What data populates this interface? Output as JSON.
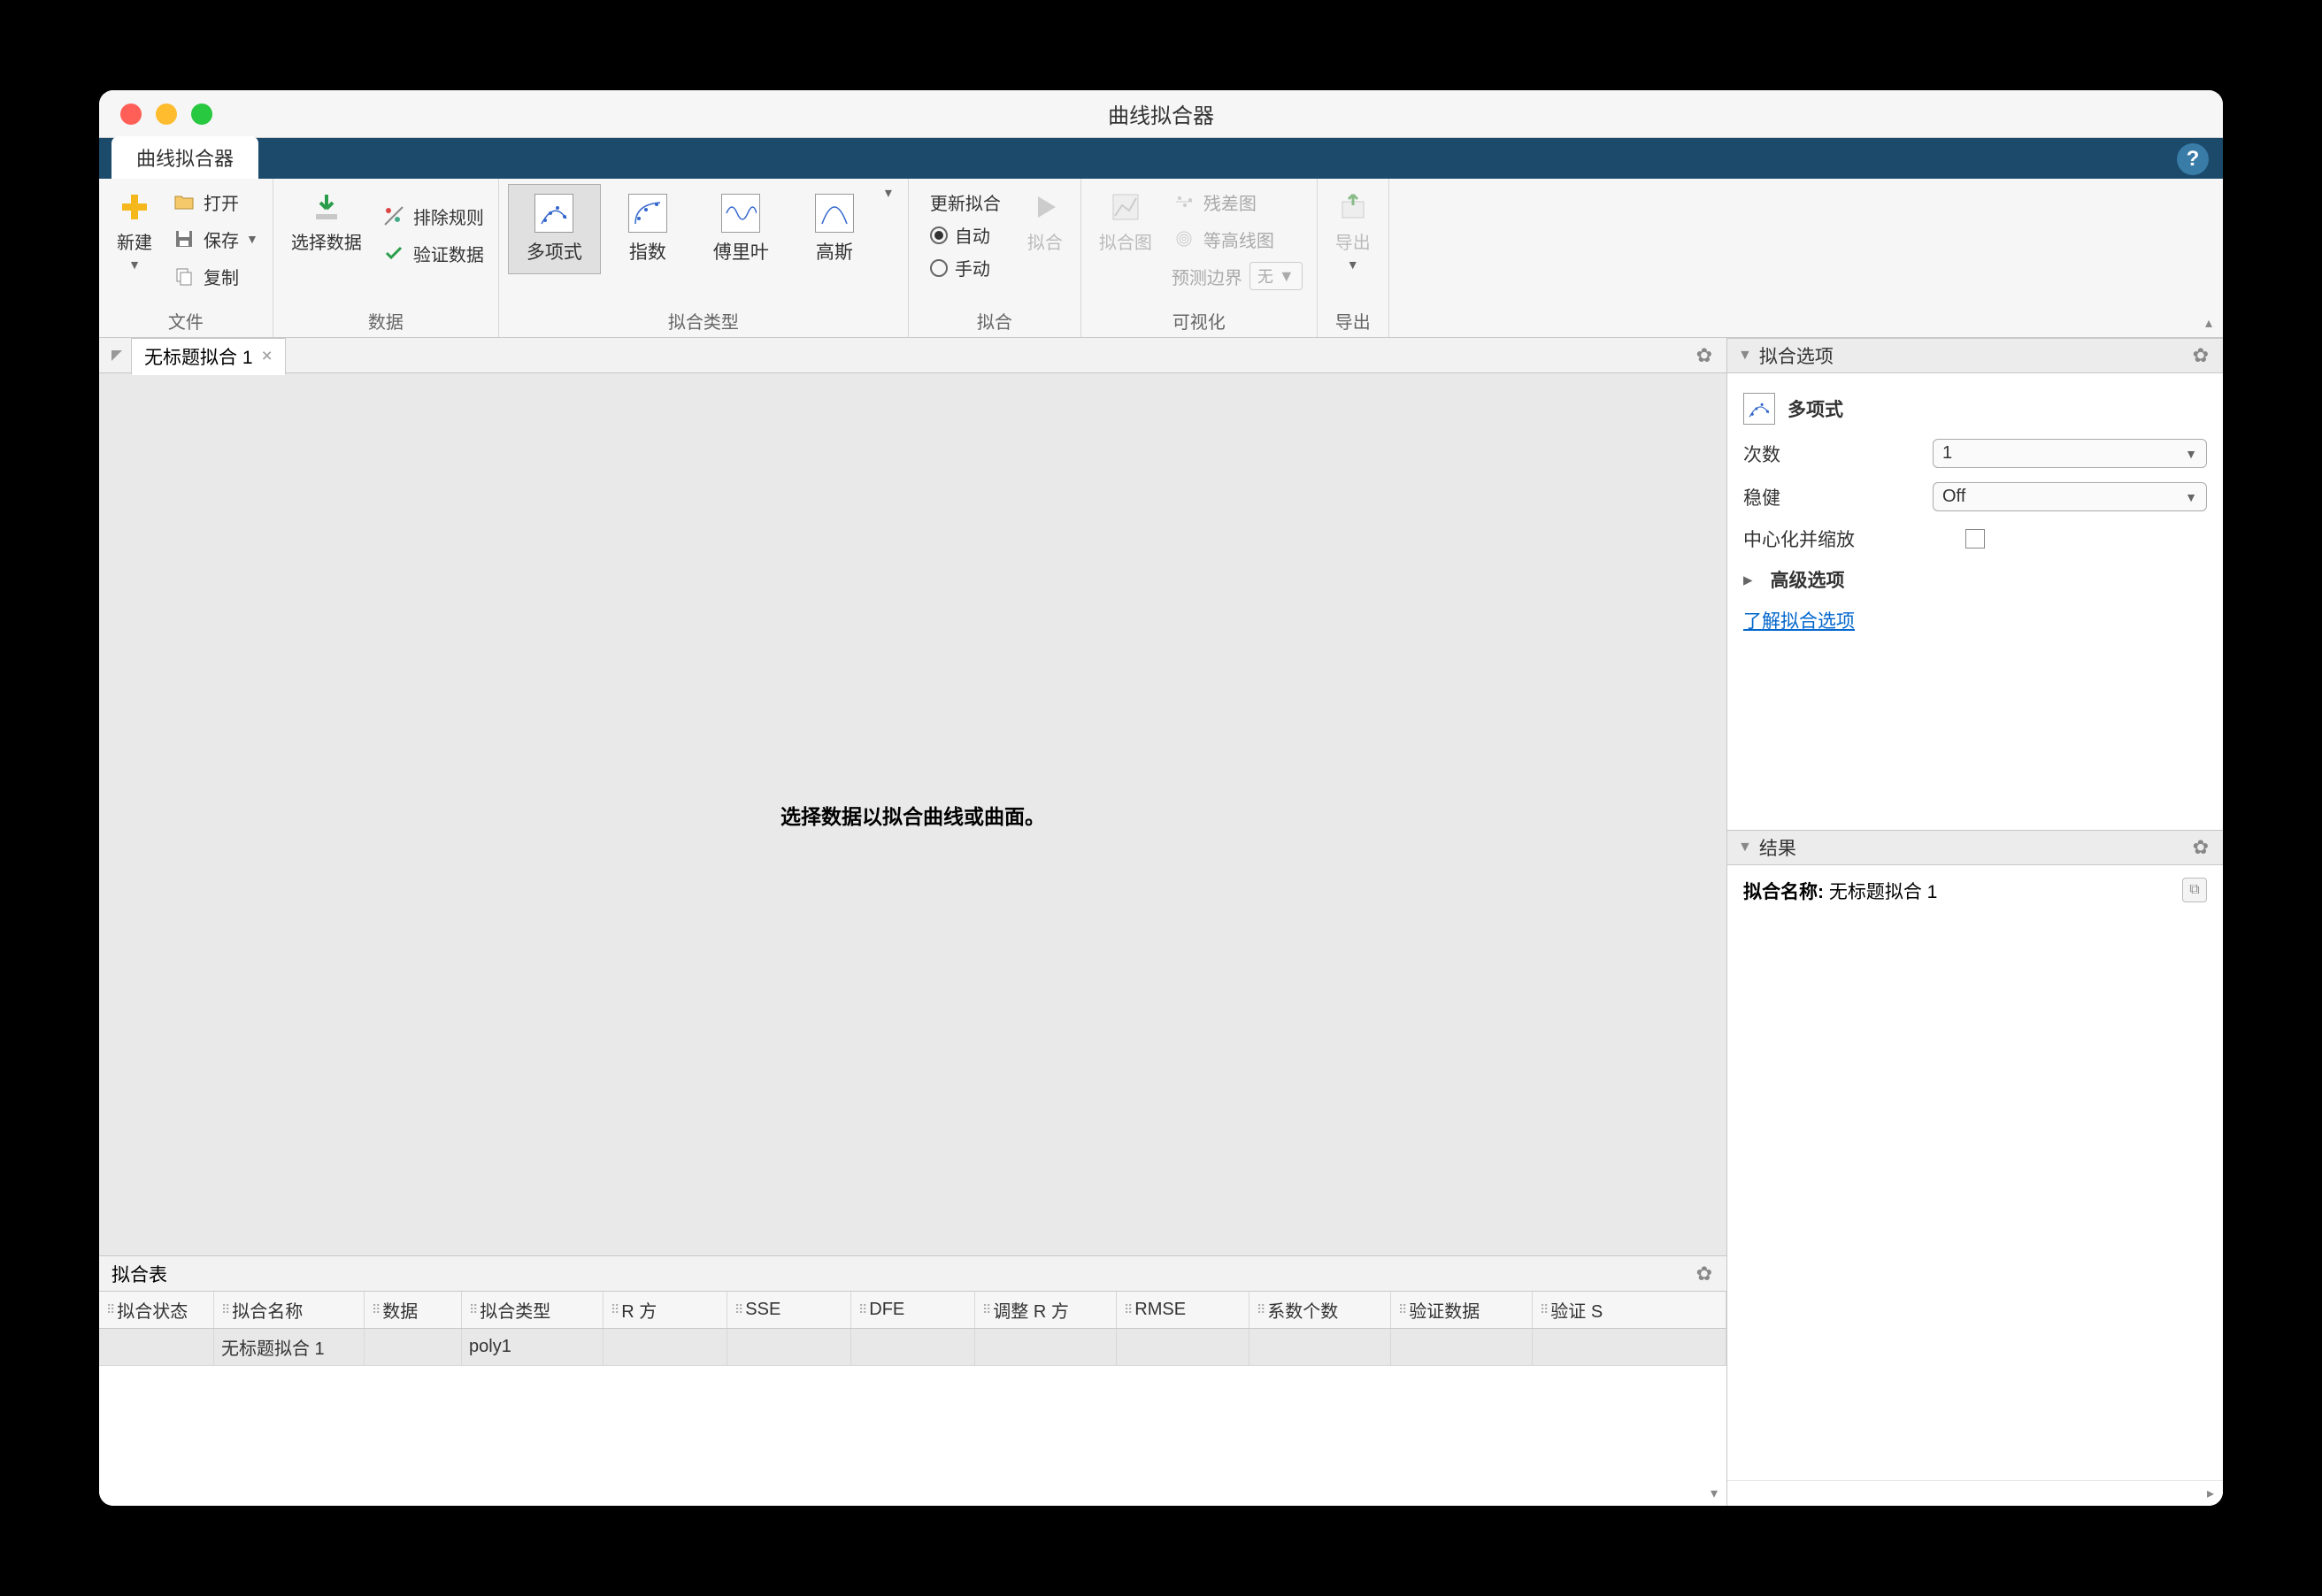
{
  "window": {
    "title": "曲线拟合器"
  },
  "app_tab": "曲线拟合器",
  "ribbon": {
    "file": {
      "new": "新建",
      "open": "打开",
      "save": "保存",
      "copy": "复制",
      "group_label": "文件"
    },
    "data": {
      "select_data": "选择数据",
      "exclude_rules": "排除规则",
      "validate_data": "验证数据",
      "group_label": "数据"
    },
    "fit_type": {
      "poly": "多项式",
      "exp": "指数",
      "fourier": "傅里叶",
      "gauss": "高斯",
      "group_label": "拟合类型"
    },
    "fit": {
      "update_fit": "更新拟合",
      "auto": "自动",
      "manual": "手动",
      "fit_btn": "拟合",
      "group_label": "拟合"
    },
    "visual": {
      "fit_plot": "拟合图",
      "residual": "残差图",
      "contour": "等高线图",
      "predict_bounds": "预测边界",
      "predict_value": "无",
      "group_label": "可视化"
    },
    "export": {
      "export": "导出",
      "group_label": "导出"
    }
  },
  "fit_tab": {
    "name": "无标题拟合 1"
  },
  "canvas_message": "选择数据以拟合曲线或曲面。",
  "fit_table": {
    "title": "拟合表",
    "columns": [
      "拟合状态",
      "拟合名称",
      "数据",
      "拟合类型",
      "R 方",
      "SSE",
      "DFE",
      "调整 R 方",
      "RMSE",
      "系数个数",
      "验证数据",
      "验证 S"
    ],
    "row": {
      "name": "无标题拟合 1",
      "type": "poly1"
    }
  },
  "options_panel": {
    "title": "拟合选项",
    "type_label": "多项式",
    "degree_label": "次数",
    "degree_value": "1",
    "robust_label": "稳健",
    "robust_value": "Off",
    "center_scale": "中心化并缩放",
    "advanced": "高级选项",
    "learn_link": "了解拟合选项"
  },
  "results_panel": {
    "title": "结果",
    "fit_name_label": "拟合名称:",
    "fit_name_value": "无标题拟合 1"
  }
}
